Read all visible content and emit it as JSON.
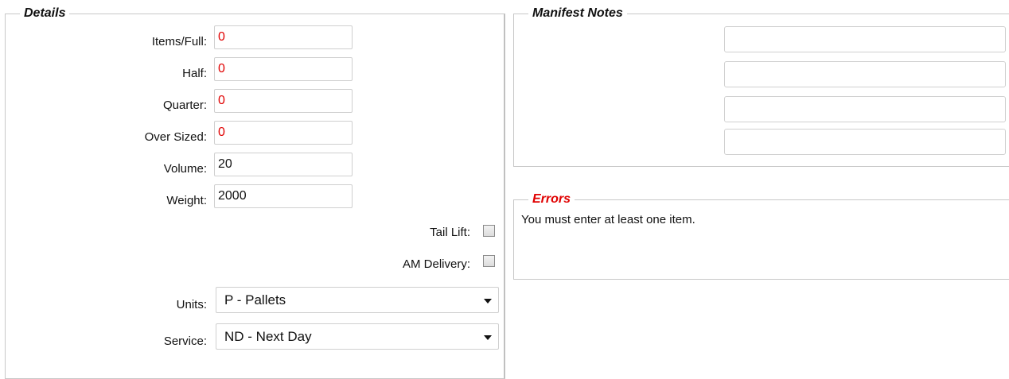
{
  "details": {
    "legend": "Details",
    "fields": [
      {
        "label": "Items/Full:",
        "value": "0"
      },
      {
        "label": "Half:",
        "value": "0"
      },
      {
        "label": "Quarter:",
        "value": "0"
      },
      {
        "label": "Over Sized:",
        "value": "0"
      },
      {
        "label": "Volume:",
        "value": "20"
      },
      {
        "label": "Weight:",
        "value": "2000"
      }
    ],
    "checkboxes": [
      {
        "label": "Tail Lift:",
        "checked": false
      },
      {
        "label": "AM Delivery:",
        "checked": false
      }
    ],
    "units": {
      "label": "Units:",
      "value": "P - Pallets"
    },
    "service": {
      "label": "Service:",
      "value": "ND - Next Day"
    }
  },
  "manifest": {
    "legend": "Manifest Notes",
    "notes": [
      "",
      "",
      "",
      ""
    ]
  },
  "errors": {
    "legend": "Errors",
    "messages": [
      "You must enter at least one item."
    ]
  }
}
